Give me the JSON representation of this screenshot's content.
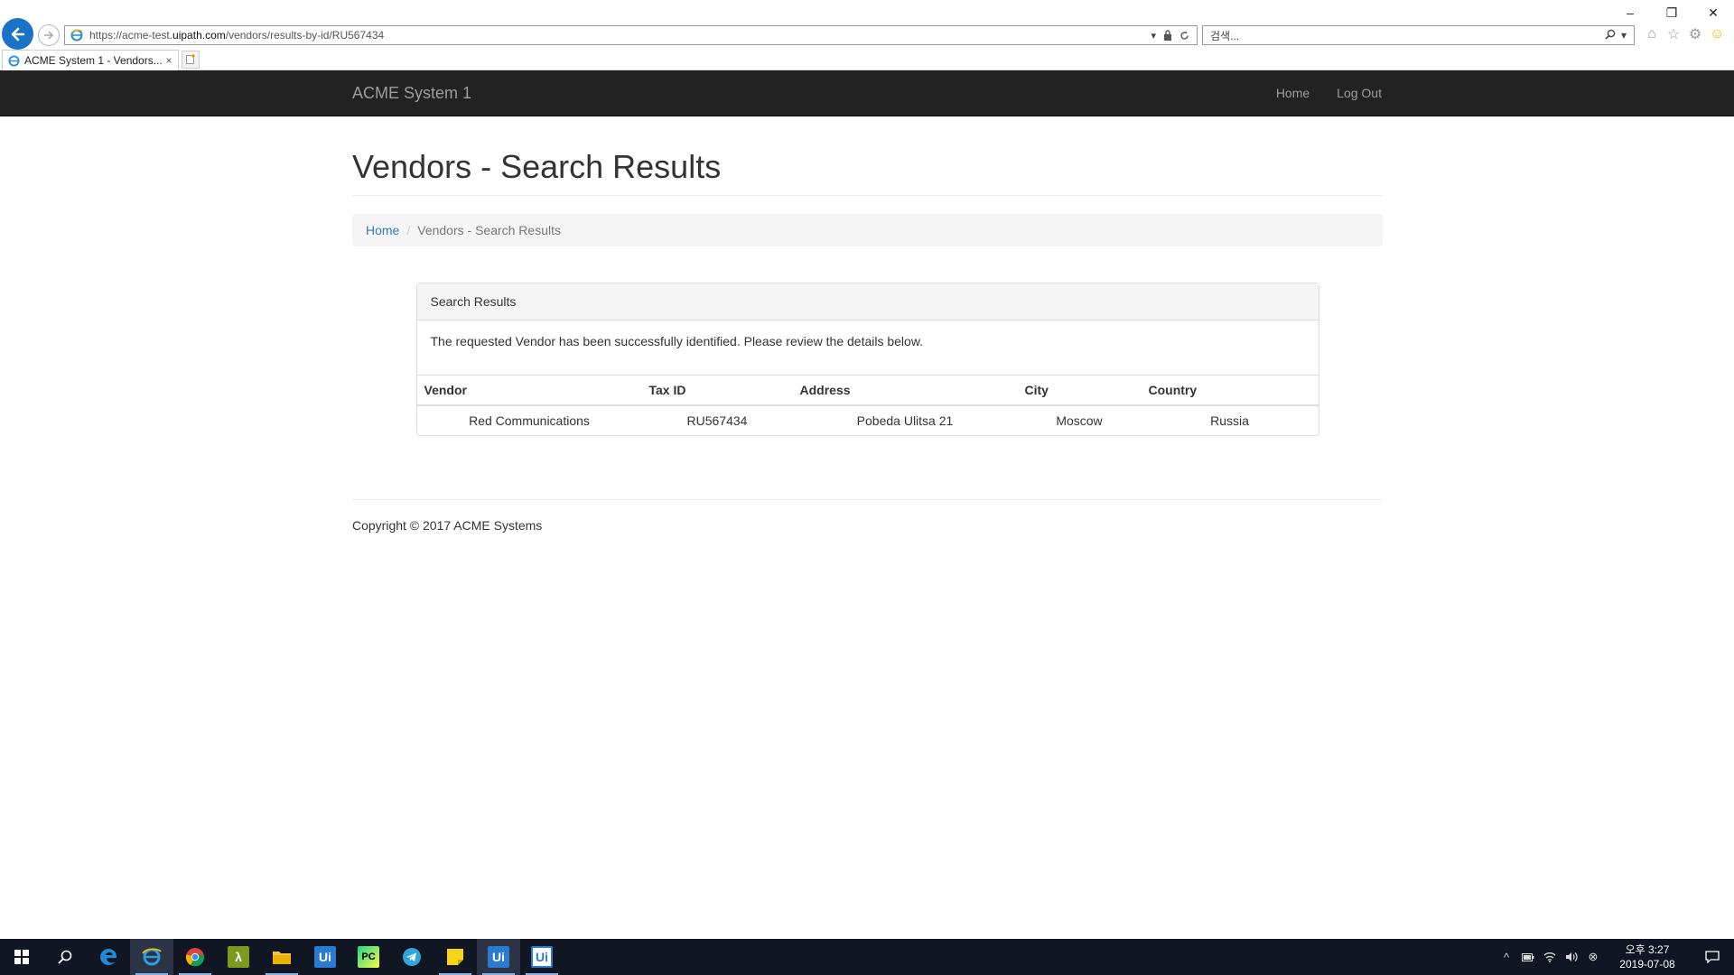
{
  "browser": {
    "url_prefix": "https://acme-test.",
    "url_host": "uipath.com",
    "url_path": "/vendors/results-by-id/RU567434",
    "search_placeholder": "검색...",
    "tab_title": "ACME System 1 - Vendors...",
    "tab_close": "×",
    "window_controls": {
      "minimize": "–",
      "restore": "❐",
      "close": "✕"
    },
    "toolbar_icons": [
      "home-icon",
      "favorites-star-icon",
      "settings-gear-icon",
      "feedback-smiley-icon"
    ]
  },
  "navbar": {
    "brand": "ACME System 1",
    "links": {
      "home": "Home",
      "logout": "Log Out"
    }
  },
  "page": {
    "title": "Vendors - Search Results",
    "breadcrumb": {
      "home": "Home",
      "separator": "/",
      "current": "Vendors - Search Results"
    },
    "panel": {
      "heading": "Search Results",
      "message": "The requested Vendor has been successfully identified. Please review the details below.",
      "columns": [
        "Vendor",
        "Tax ID",
        "Address",
        "City",
        "Country"
      ],
      "rows": [
        [
          "Red Communications",
          "RU567434",
          "Pobeda Ulitsa 21",
          "Moscow",
          "Russia"
        ]
      ]
    },
    "footer": "Copyright © 2017 ACME Systems"
  },
  "taskbar": {
    "apps": [
      "start-windows-icon",
      "search-icon",
      "edge-icon",
      "internet-explorer-icon",
      "chrome-icon",
      "lambda-app-icon",
      "file-explorer-icon",
      "uipath-studio-icon",
      "pycharm-icon",
      "telegram-icon",
      "sticky-notes-icon",
      "uipath-robot-icon",
      "uipath-orchestrator-icon"
    ],
    "tile_labels": {
      "lambda": "λ",
      "ui1": "Ui",
      "pycharm": "PC",
      "ui2": "Ui",
      "ui3": "Ui"
    },
    "clock_time": "오후 3:27",
    "clock_date": "2019-07-08"
  },
  "colors": {
    "navbar_bg": "#222222",
    "navbar_text": "#9d9d9d",
    "link": "#337ab7",
    "taskbar_bg": "#101622"
  }
}
